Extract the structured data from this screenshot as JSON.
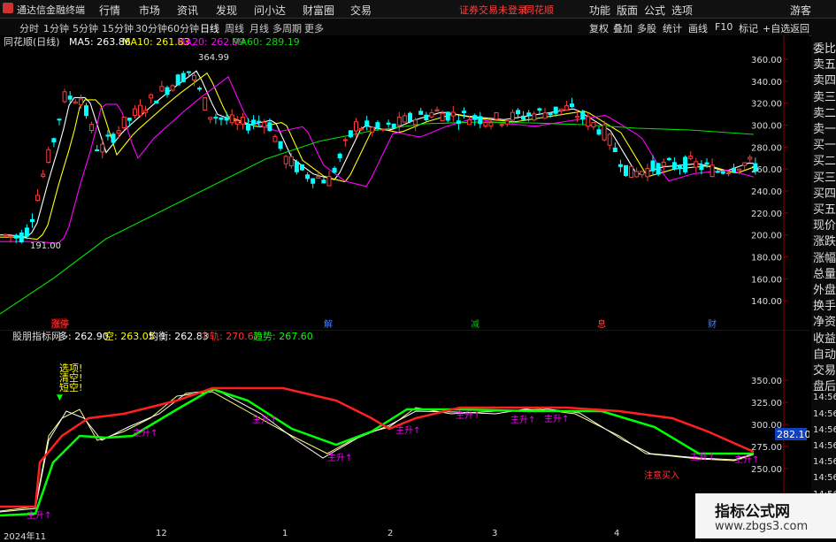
{
  "menubar": {
    "app": "通达信金融终端",
    "items": [
      "行情",
      "市场",
      "资讯",
      "发现",
      "问小达",
      "财富圈",
      "交易"
    ],
    "notice": "证券交易未登录",
    "notice_brand": "同花顺",
    "right": [
      "功能",
      "版面",
      "公式",
      "选项"
    ],
    "user": "游客"
  },
  "tabs": {
    "items": [
      "分时",
      "1分钟",
      "5分钟",
      "15分钟",
      "30分钟",
      "60分钟",
      "日线",
      "周线",
      "月线",
      "多周期",
      "更多"
    ],
    "active": "日线",
    "tools": [
      "复权",
      "叠加",
      "多股",
      "统计",
      "画线",
      "F10",
      "标记",
      "+自选",
      "返回"
    ]
  },
  "kchart": {
    "title": "同花顺(日线)",
    "ma": [
      {
        "label": "MA5: 263.86",
        "color": "#ffffff"
      },
      {
        "label": "MA10: 261.83",
        "color": "#ffff00"
      },
      {
        "label": "MA20: 262.99",
        "color": "#ff00ff"
      },
      {
        "label": "MA60: 289.19",
        "color": "#00e000"
      }
    ],
    "high_label": "364.99",
    "low_label": "191.00",
    "yticks": [
      "360.00",
      "340.00",
      "320.00",
      "300.00",
      "280.00",
      "260.00",
      "240.00",
      "220.00",
      "200.00",
      "180.00",
      "160.00",
      "140.00"
    ],
    "events": [
      {
        "text": "涨停",
        "color": "#ff4040"
      },
      {
        "text": "解",
        "color": "#4080ff"
      },
      {
        "text": "减",
        "color": "#00c000"
      },
      {
        "text": "息",
        "color": "#ff4040"
      },
      {
        "text": "财",
        "color": "#4080ff"
      }
    ]
  },
  "ichart": {
    "title": "股朋指标网",
    "values": [
      {
        "label": "多: 262.90",
        "color": "#ffffff"
      },
      {
        "label": "空: 263.05",
        "color": "#ffff00"
      },
      {
        "label": "均衡: 262.83",
        "color": "#ffffff"
      },
      {
        "label": "中轨: 270.67",
        "color": "#ff3030"
      },
      {
        "label": "趋势: 267.60",
        "color": "#00ff00"
      }
    ],
    "yticks": [
      "350.00",
      "325.00",
      "300.00",
      "275.00",
      "250.00"
    ],
    "price_tag": "282.10",
    "marks": [
      "选项!",
      "清空!",
      "短空!"
    ],
    "rise": "主升↑",
    "attention": "注意买入"
  },
  "dates": [
    "2024年11",
    "12",
    "1",
    "2",
    "3",
    "4"
  ],
  "right_side": [
    "委比",
    "卖五",
    "卖四",
    "卖三",
    "卖二",
    "卖一",
    "买一",
    "买二",
    "买三",
    "买四",
    "买五",
    "现价",
    "涨跌",
    "涨幅",
    "总量",
    "外盘",
    "换手",
    "净资",
    "收益",
    "自动",
    "交易",
    "盘后",
    "14:56",
    "14:56",
    "14:56",
    "14:56",
    "14:56",
    "14:56",
    "14:56",
    "14:56"
  ],
  "watermark": {
    "title": "指标公式网",
    "url": "www.zbgs3.com"
  },
  "colors": {
    "up": "#ff3c3c",
    "down": "#00ffff",
    "ma5": "#ffffff",
    "ma10": "#ffff00",
    "ma20": "#ff00ff",
    "ma60": "#00e000",
    "trend": "#00ff00",
    "mid": "#ff2020"
  }
}
